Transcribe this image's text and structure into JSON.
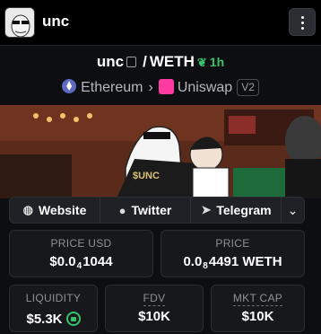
{
  "header": {
    "token_name": "unc",
    "menu_icon": "vertical-dots-icon"
  },
  "pair": {
    "base": "unc",
    "separator": "/",
    "quote": "WETH",
    "age": "1h",
    "age_icon": "sprout-icon",
    "copy_icon": "copy-icon"
  },
  "chain": {
    "network": "Ethereum",
    "dex": "Uniswap",
    "version": "V2"
  },
  "links": {
    "website": "Website",
    "twitter": "Twitter",
    "telegram": "Telegram"
  },
  "stats": {
    "price_usd_label": "PRICE USD",
    "price_usd_prefix": "$0.0",
    "price_usd_zeros": "4",
    "price_usd_digits": "1044",
    "price_label": "PRICE",
    "price_prefix": "0.0",
    "price_zeros": "8",
    "price_digits": "4491 WETH",
    "liquidity_label": "LIQUIDITY",
    "liquidity_value": "$5.3K",
    "fdv_label": "FDV",
    "fdv_value": "$10K",
    "mktcap_label": "MKT CAP",
    "mktcap_value": "$10K"
  },
  "colors": {
    "accent_green": "#35c26b",
    "uniswap_pink": "#ff3aa0",
    "ethereum_blue": "#5c6bc0"
  }
}
